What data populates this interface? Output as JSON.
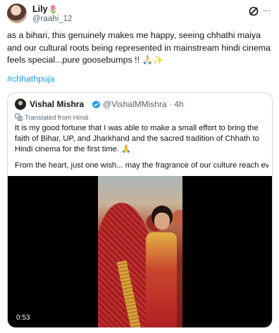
{
  "post": {
    "author_name": "Lily",
    "author_handle": "@raahi_12",
    "text": "as a bihari, this genuinely makes me happy, seeing chhathi maiya and our cultural roots being represented in mainstream hindi cinema feels special...pure goosebumps !! 🙏🏻✨",
    "hashtag": "#chhathpuja"
  },
  "quote": {
    "author_name": "Vishal Mishra",
    "meta": "@VishalMMishra · 4h",
    "translated_label": "Translated from Hindi",
    "text": "It is my good fortune that I was able to make a small effort to bring the faith of Bihar, UP, and Jharkhand and the sacred tradition of Chhath to Hindi cinema for the first time. 🙏",
    "text2": "From the heart, just one wish... may the fragrance of our culture reach every ...",
    "video_timestamp": "0:53"
  },
  "colors": {
    "link": "#1d9bf0",
    "verified": "#1d9bf0",
    "secondary_text": "#536471",
    "border": "#cfd9de"
  },
  "icons": [
    "tulip-emoji",
    "grok-icon",
    "more-icon",
    "verified-badge-icon",
    "translate-icon"
  ]
}
